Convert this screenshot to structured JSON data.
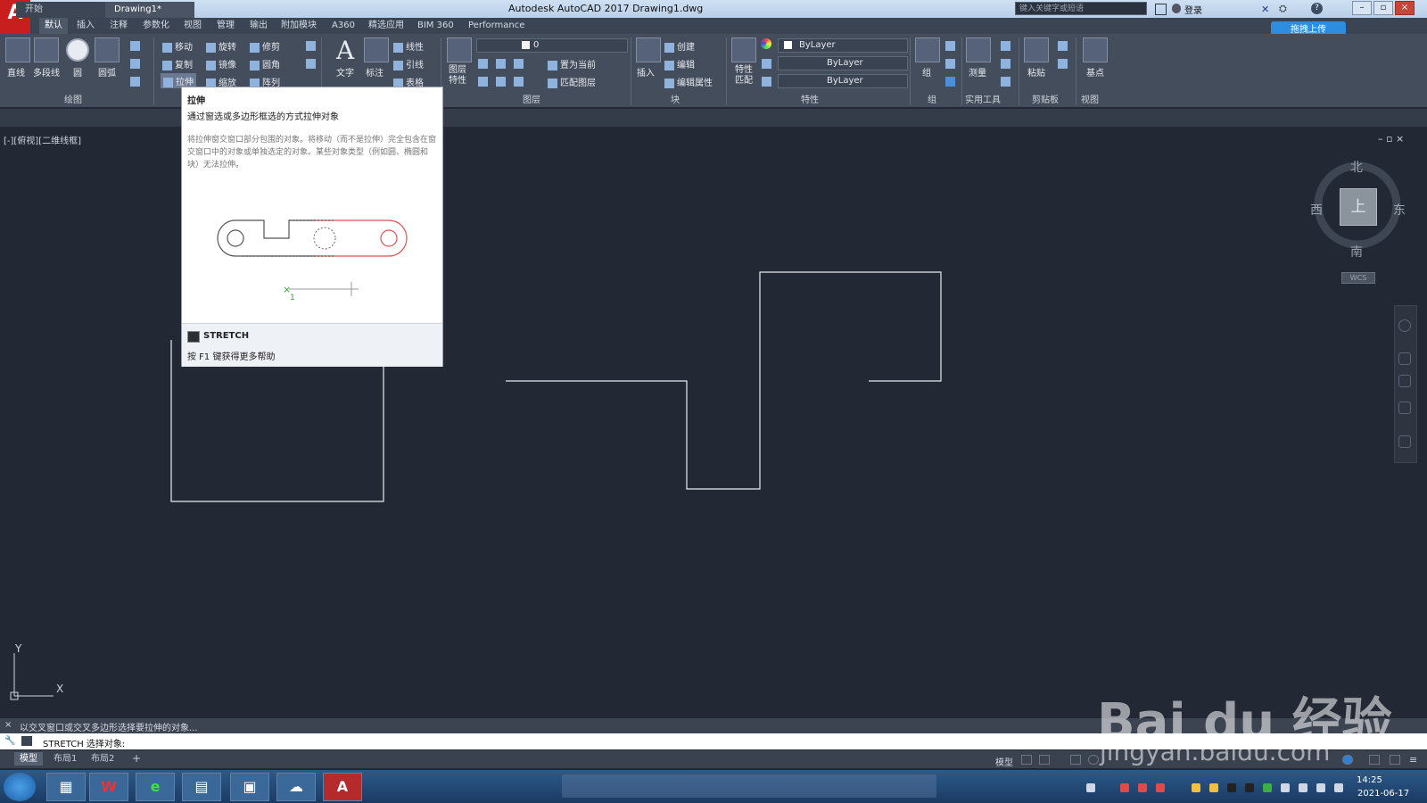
{
  "app": {
    "logo_letter": "A",
    "title": "Autodesk AutoCAD 2017    Drawing1.dwg",
    "search_placeholder": "键入关键字或短语",
    "login": "登录",
    "upload_button": "拖拽上传"
  },
  "ribbon_tabs": [
    "默认",
    "插入",
    "注释",
    "参数化",
    "视图",
    "管理",
    "输出",
    "附加模块",
    "A360",
    "精选应用",
    "BIM 360",
    "Performance"
  ],
  "ribbon": {
    "draw": {
      "line": "直线",
      "polyline": "多段线",
      "circle": "圆",
      "arc": "圆弧",
      "panel": "绘图"
    },
    "modify": {
      "move": "移动",
      "rotate": "旋转",
      "trim": "修剪",
      "copy": "复制",
      "mirror": "镜像",
      "fillet": "圆角",
      "stretch": "拉伸",
      "scale": "缩放",
      "array": "阵列"
    },
    "annotation": {
      "text": "文字",
      "dimension": "标注",
      "linear": "线性",
      "leader": "引线",
      "table": "表格"
    },
    "layers": {
      "properties": "图层\n特性",
      "layer_value": "0",
      "set_current": "置为当前",
      "match_layer": "匹配图层",
      "panel": "图层"
    },
    "block": {
      "insert": "插入",
      "create": "创建",
      "edit": "编辑",
      "edit_attr": "编辑属性",
      "panel": "块"
    },
    "properties": {
      "match": "特性\n匹配",
      "bylayer1": "ByLayer",
      "bylayer2": "ByLayer",
      "bylayer3": "ByLayer",
      "panel": "特性"
    },
    "groups": {
      "group": "组",
      "panel": "组"
    },
    "utilities": {
      "measure": "测量",
      "panel": "实用工具"
    },
    "clipboard": {
      "paste": "粘贴",
      "panel": "剪贴板"
    },
    "view": {
      "base": "基点",
      "panel": "视图"
    }
  },
  "file_tabs": {
    "start": "开始",
    "drawing": "Drawing1*"
  },
  "viewport_label": "[-][俯视][二维线框]",
  "viewport_controls": "–  ▫  ×",
  "tooltip": {
    "title": "拉伸",
    "description": "通过窗选或多边形框选的方式拉伸对象",
    "detail": "将拉伸窗交窗口部分包围的对象。将移动（而不是拉伸）完全包含在窗交窗口中的对象或单独选定的对象。某些对象类型（例如圆、椭圆和块）无法拉伸。",
    "point_label": "1",
    "command": "STRETCH",
    "help": "按 F1 键获得更多帮助"
  },
  "viewcube": {
    "north": "北",
    "south": "南",
    "west": "西",
    "east": "东",
    "top": "上",
    "wcs": "WCS"
  },
  "ucs": {
    "x": "X",
    "y": "Y"
  },
  "command_line": {
    "history": "以交叉窗口或交叉多边形选择要拉伸的对象...",
    "input": "STRETCH 选择对象:"
  },
  "layout_tabs": [
    "模型",
    "布局1",
    "布局2"
  ],
  "status": {
    "model": "模型"
  },
  "taskbar": {
    "time": "14:25",
    "date": "2021-06-17"
  },
  "watermark": {
    "brand": "Bai du 经验",
    "url": "jingyan.baidu.com"
  },
  "colors": {
    "canvas": "#222935",
    "ribbon": "#444d5c",
    "accent": "#2f8de0",
    "tooltip_red": "#e05050"
  }
}
